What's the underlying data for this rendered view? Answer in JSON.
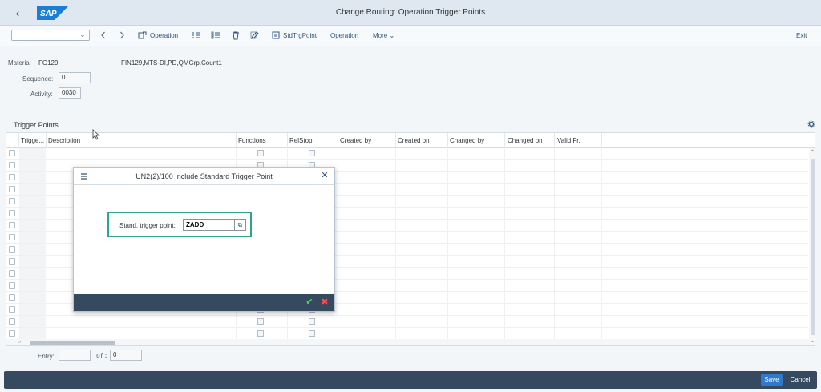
{
  "shell": {
    "title": "Change Routing: Operation Trigger Points",
    "logo_text": "SAP"
  },
  "toolbar": {
    "select_value": "",
    "operation_1": "Operation",
    "std_trg_point": "StdTrgPoint",
    "operation_2": "Operation",
    "more": "More",
    "exit": "Exit"
  },
  "header": {
    "material_label": "Material",
    "material_value": "FG129",
    "material_desc": "FIN129,MTS-DI,PD,QMGrp.Count1",
    "sequence_label": "Sequence:",
    "sequence_value": "0",
    "activity_label": "Activity:",
    "activity_value": "0030"
  },
  "table": {
    "title": "Trigger Points",
    "columns": [
      "Trigge...",
      "Description",
      "Functions",
      "RelStop",
      "Created by",
      "Created on",
      "Changed by",
      "Changed on",
      "Valid Fr."
    ]
  },
  "footer": {
    "entry_label": "Entry:",
    "entry_value": "",
    "of_label": "of:",
    "of_value": "0"
  },
  "actions": {
    "save": "Save",
    "cancel": "Cancel"
  },
  "dialog": {
    "title": "UN2(2)/100 Include Standard Trigger Point",
    "field_label": "Stand. trigger point:",
    "field_value": "ZADD"
  },
  "colors": {
    "shell_bg": "#dfe8f0",
    "footer_bar": "#354a5f",
    "accent": "#2f7acb",
    "focus_border": "#2ea48c"
  }
}
